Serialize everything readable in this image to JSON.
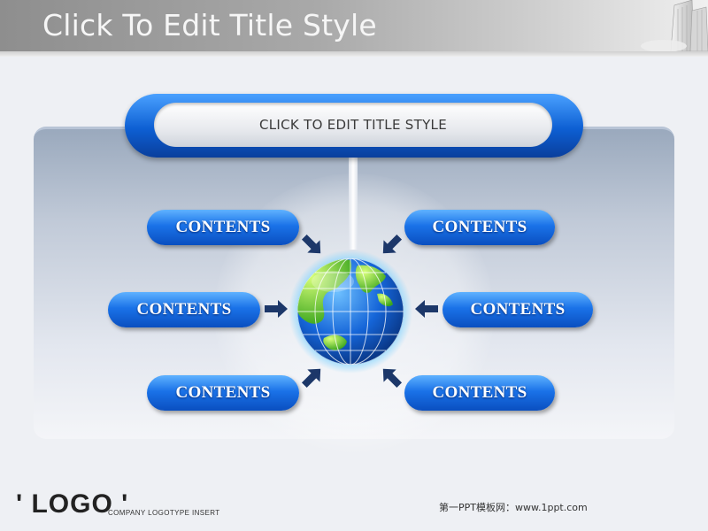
{
  "slide": {
    "title": "Click To Edit Title Style",
    "subtitle_box": "CLICK TO EDIT TITLE STYLE"
  },
  "contents": {
    "top_left": "CONTENTS",
    "top_right": "CONTENTS",
    "mid_left": "CONTENTS",
    "mid_right": "CONTENTS",
    "bottom_left": "CONTENTS",
    "bottom_right": "CONTENTS"
  },
  "footer": {
    "logo": "' LOGO '",
    "logo_tagline": "COMPANY LOGOTYPE INSERT",
    "note": "第一PPT模板网：www.1ppt.com"
  },
  "icons": {
    "center": "globe-icon",
    "corner": "skyscraper-icon",
    "pointers": "arrow-icon"
  },
  "colors": {
    "accent_blue": "#1a72e8",
    "arrow_navy": "#1c3769",
    "globe_green": "#7bd63a"
  }
}
